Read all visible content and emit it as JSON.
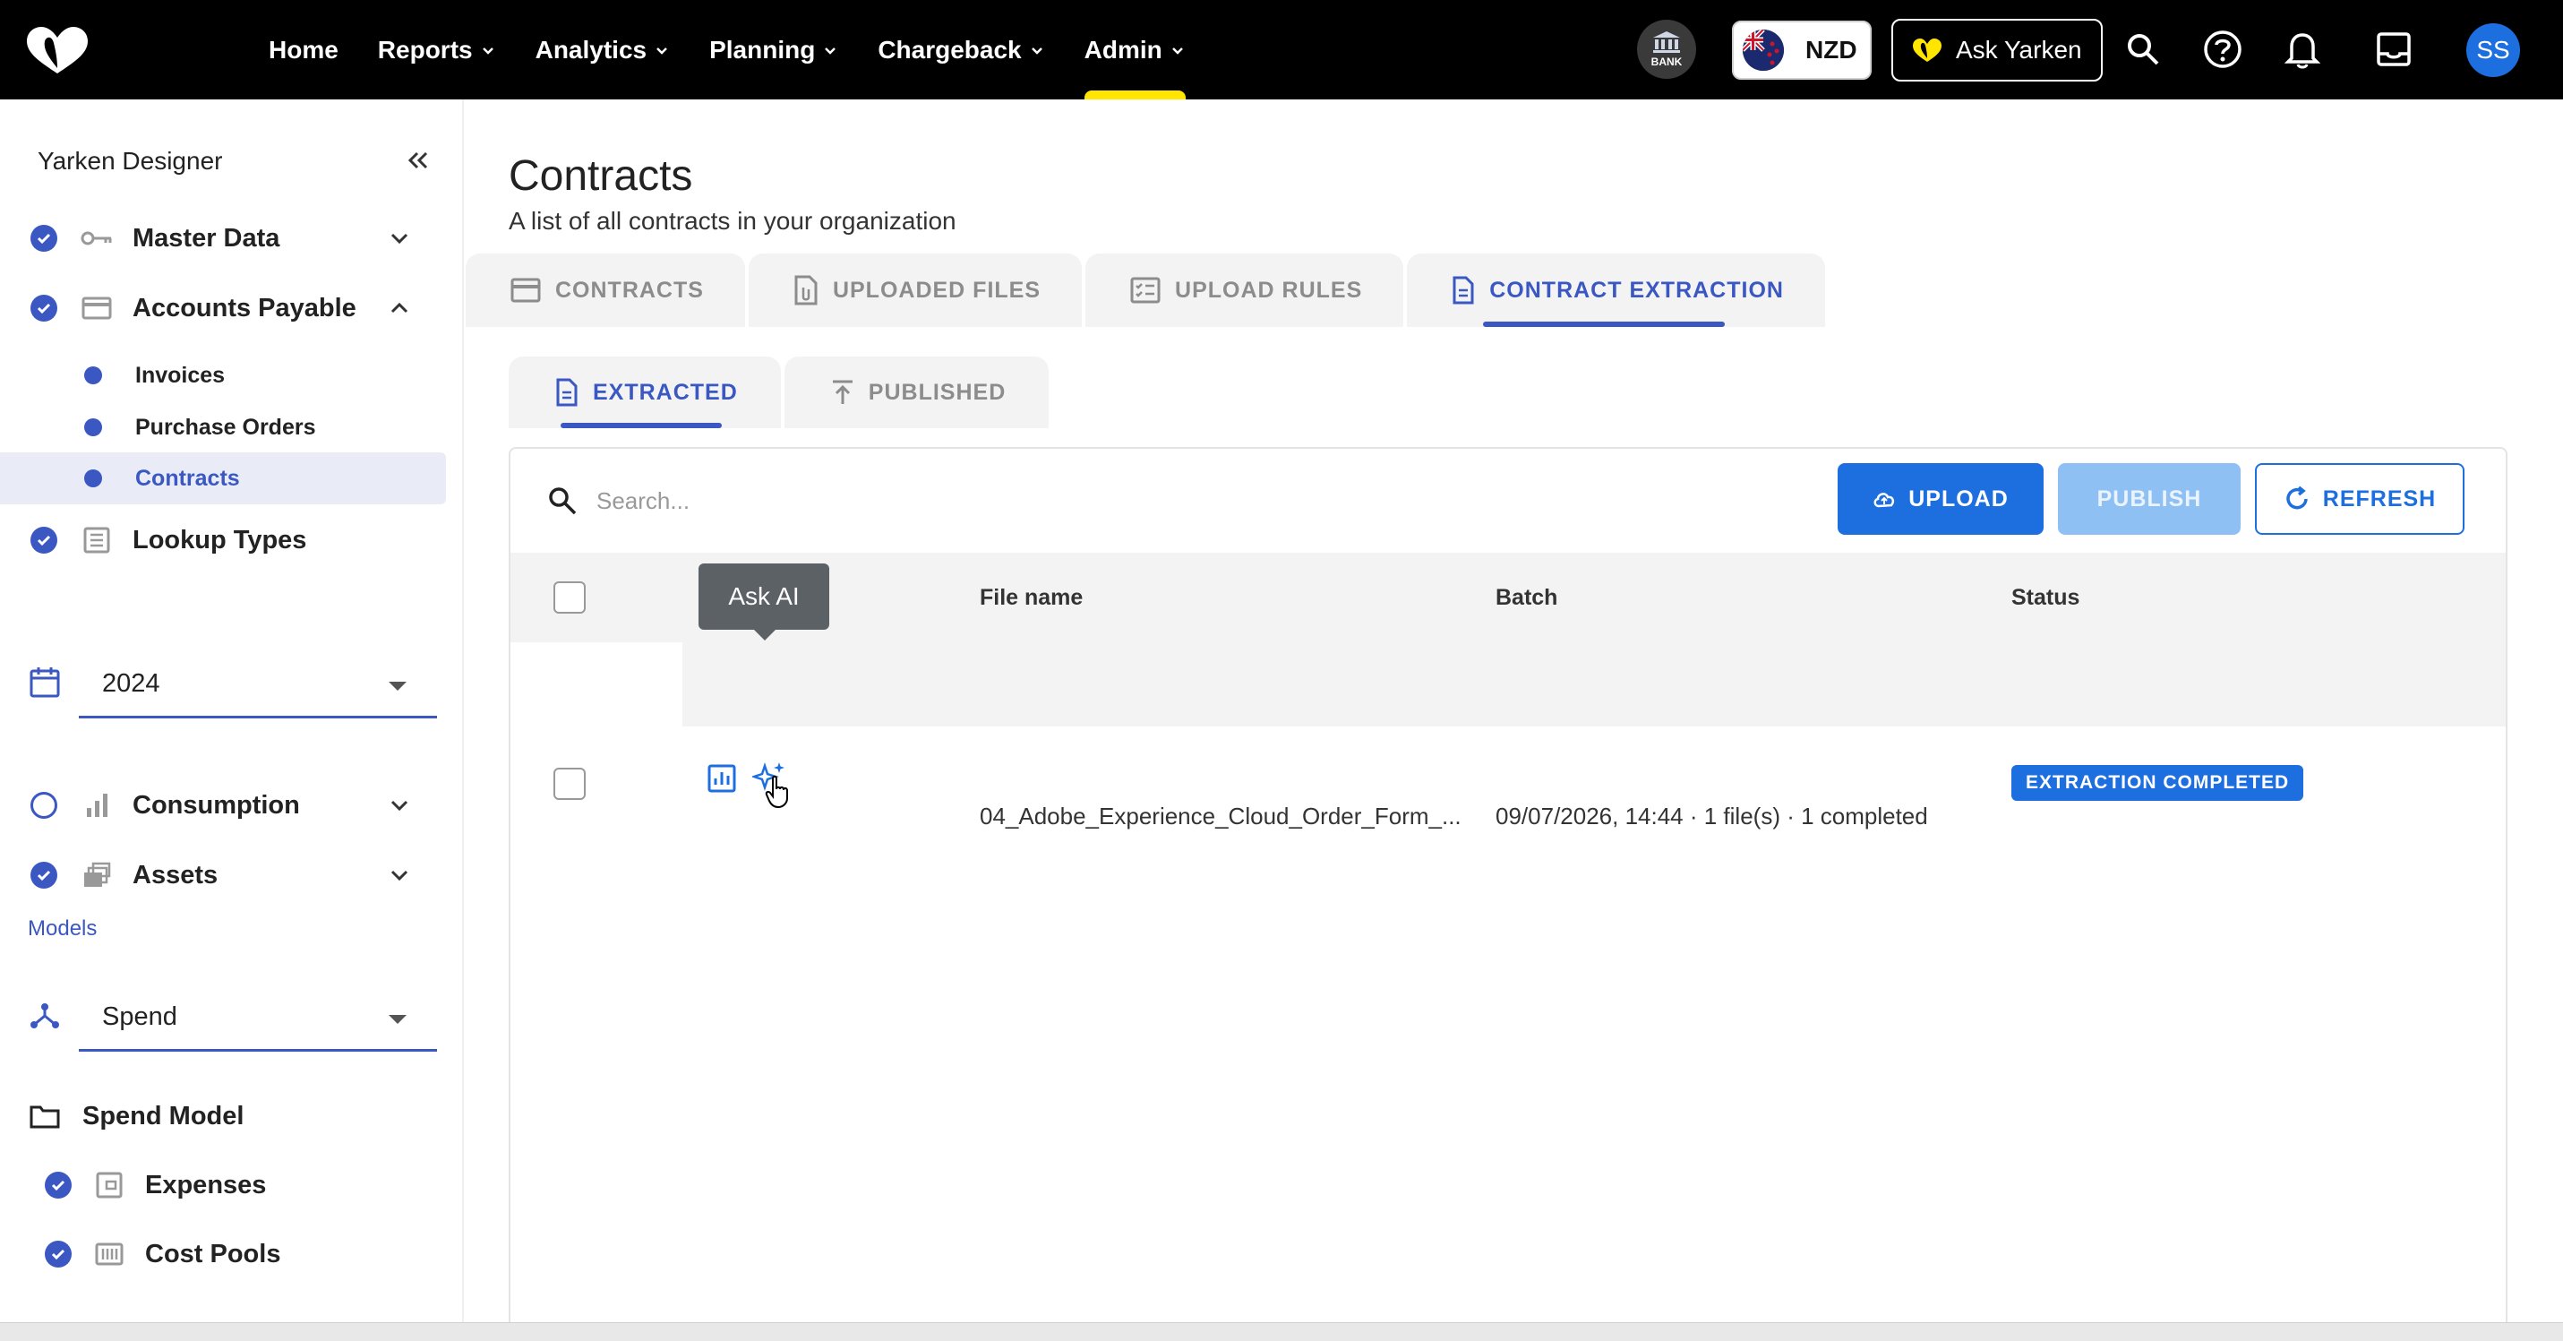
{
  "topbar": {
    "nav": [
      {
        "label": "Home",
        "has_menu": false,
        "active": false
      },
      {
        "label": "Reports",
        "has_menu": true,
        "active": false
      },
      {
        "label": "Analytics",
        "has_menu": true,
        "active": false
      },
      {
        "label": "Planning",
        "has_menu": true,
        "active": false
      },
      {
        "label": "Chargeback",
        "has_menu": true,
        "active": false
      },
      {
        "label": "Admin",
        "has_menu": true,
        "active": true
      }
    ],
    "bank_label": "BANK",
    "currency": "NZD",
    "ask_label": "Ask Yarken",
    "avatar_initials": "SS",
    "accent_color": "#ffe500"
  },
  "sidebar": {
    "title": "Yarken Designer",
    "sections": {
      "master_data": "Master Data",
      "accounts_payable": "Accounts Payable",
      "invoices": "Invoices",
      "purchase_orders": "Purchase Orders",
      "contracts": "Contracts",
      "lookup_types": "Lookup Types",
      "consumption": "Consumption",
      "assets": "Assets",
      "spend_model": "Spend Model",
      "expenses": "Expenses",
      "cost_pools": "Cost Pools"
    },
    "year_select": "2024",
    "models_label": "Models",
    "model_select": "Spend"
  },
  "main": {
    "title": "Contracts",
    "subtitle": "A list of all contracts in your organization",
    "tabs": [
      {
        "label": "CONTRACTS",
        "icon": "card-icon"
      },
      {
        "label": "UPLOADED FILES",
        "icon": "file-icon"
      },
      {
        "label": "UPLOAD RULES",
        "icon": "rules-icon"
      },
      {
        "label": "CONTRACT EXTRACTION",
        "icon": "document-icon"
      }
    ],
    "subtabs": [
      {
        "label": "EXTRACTED",
        "icon": "document-icon"
      },
      {
        "label": "PUBLISHED",
        "icon": "upload-arrow-icon"
      }
    ],
    "search_placeholder": "Search...",
    "buttons": {
      "upload": "UPLOAD",
      "publish": "PUBLISH",
      "refresh": "REFRESH"
    },
    "table": {
      "headers": {
        "file_name": "File name",
        "batch": "Batch",
        "status": "Status"
      },
      "rows": [
        {
          "file_name": "04_Adobe_Experience_Cloud_Order_Form_...",
          "batch": "09/07/2026, 14:44 · 1 file(s) · 1 completed",
          "status": "EXTRACTION COMPLETED"
        }
      ]
    },
    "tooltip": "Ask AI"
  },
  "colors": {
    "primary": "#1d6fe0",
    "brand_blue": "#3a57c2",
    "status_completed": "#1d6fe0"
  }
}
